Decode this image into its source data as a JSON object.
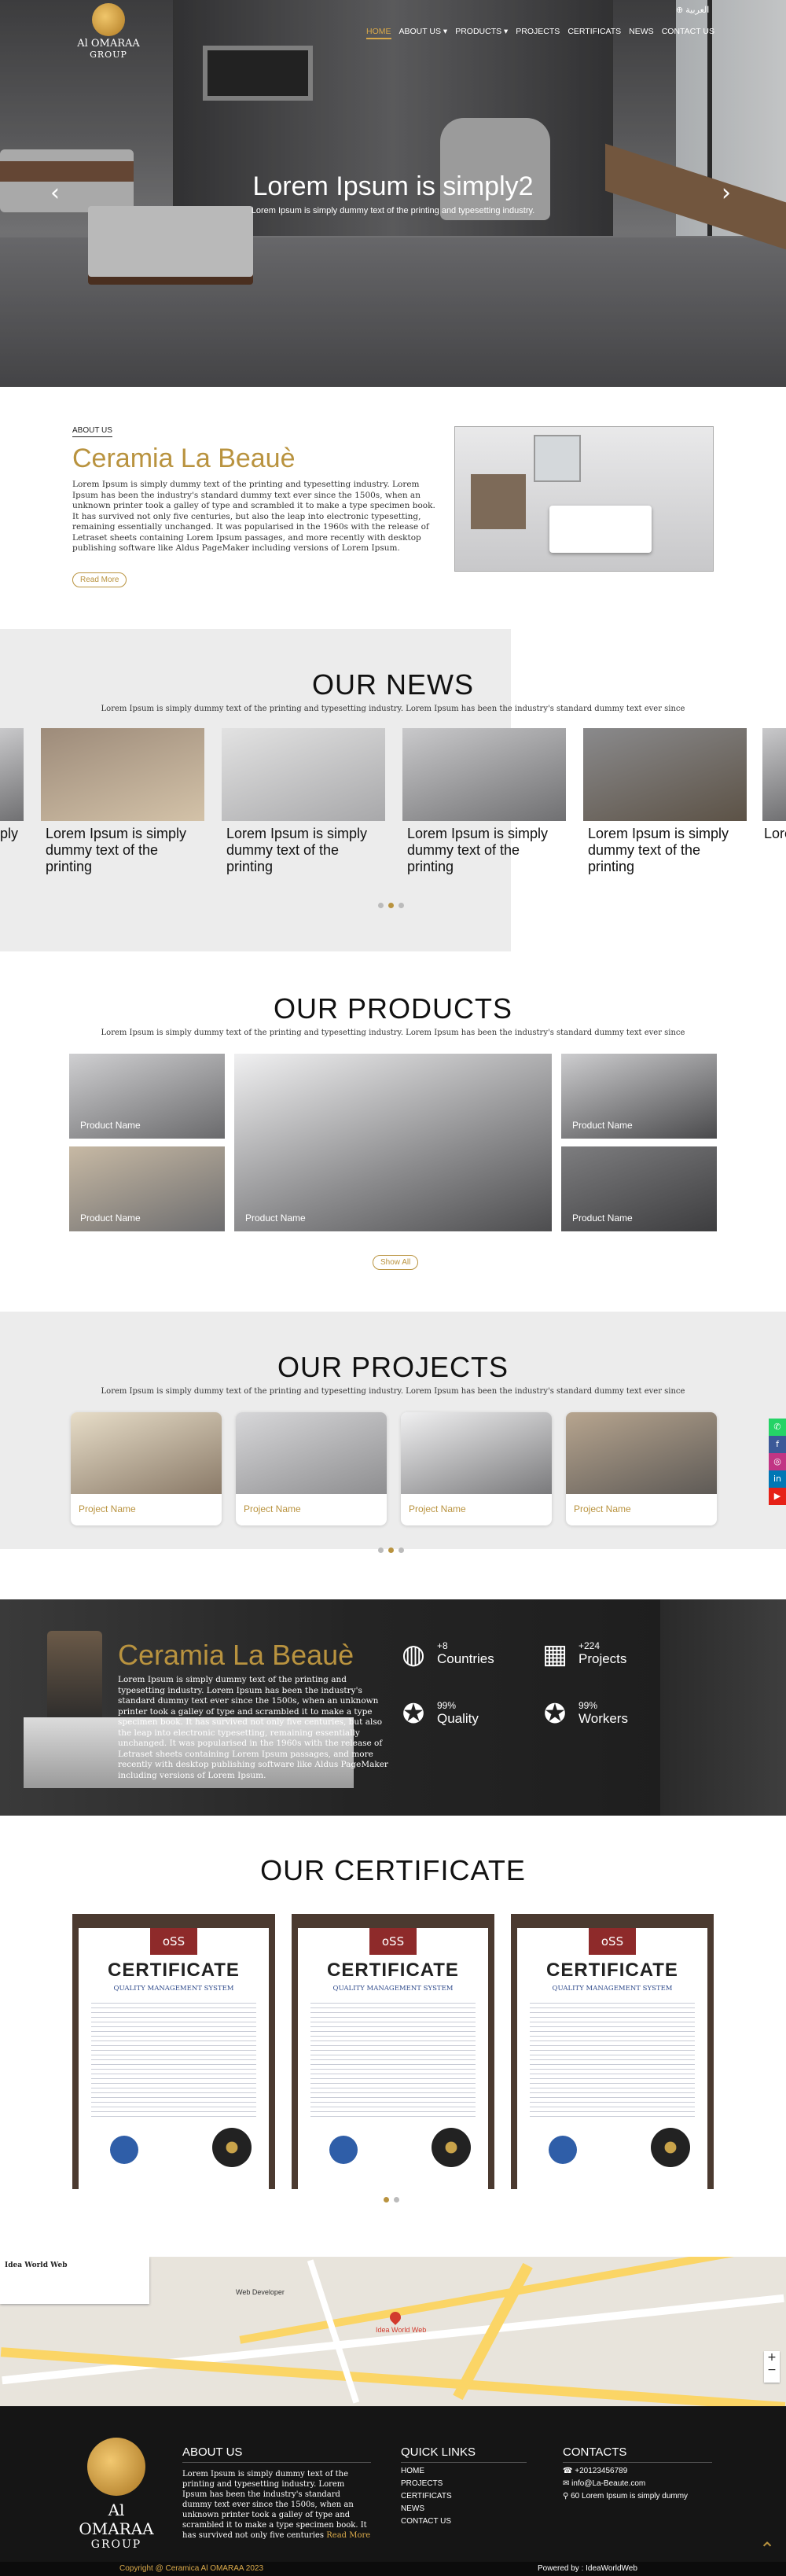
{
  "header": {
    "logo_line1": "Al OMARAA",
    "logo_line2": "GROUP",
    "nav": [
      "HOME",
      "ABOUT US ▾",
      "PRODUCTS ▾",
      "PROJECTS",
      "CERTIFICATS",
      "NEWS",
      "CONTACT US"
    ],
    "language": "العربية"
  },
  "hero": {
    "title": "Lorem Ipsum is simply2",
    "subtitle": "Lorem Ipsum is simply dummy text of the printing and typesetting industry."
  },
  "about": {
    "kicker": "ABOUT US",
    "title": "Ceramia La Beauè",
    "text": "Lorem Ipsum is simply dummy text of the printing and typesetting industry. Lorem Ipsum has been the industry's standard dummy text ever since the 1500s, when an unknown printer took a galley of type and scrambled it to make a type specimen book. It has survived not only five centuries, but also the leap into electronic typesetting, remaining essentially unchanged. It was popularised in the 1960s with the release of Letraset sheets containing Lorem Ipsum passages, and more recently with desktop publishing software like Aldus PageMaker including versions of Lorem Ipsum.",
    "button": "Read More"
  },
  "news": {
    "title": "OUR NEWS",
    "subtitle": "Lorem Ipsum is simply dummy text of the printing and typesetting industry. Lorem Ipsum has been the industry's standard dummy text ever since",
    "items": [
      {
        "text": "ply"
      },
      {
        "text": "Lorem Ipsum is simply dummy text of the printing"
      },
      {
        "text": "Lorem Ipsum is simply dummy text of the printing"
      },
      {
        "text": "Lorem Ipsum is simply dummy text of the printing"
      },
      {
        "text": "Lorem Ipsum is simply dummy text of the printing"
      },
      {
        "text": "Lorem"
      }
    ]
  },
  "products": {
    "title": "OUR PRODUCTS",
    "subtitle": "Lorem Ipsum is simply dummy text of the printing and typesetting industry. Lorem Ipsum has been the industry's standard dummy text ever since",
    "items": [
      "Product Name",
      "Product Name",
      "Product Name",
      "Product Name",
      "Product Name",
      "Product Name"
    ],
    "button": "Show All"
  },
  "projects": {
    "title": "OUR PROJECTS",
    "subtitle": "Lorem Ipsum is simply dummy text of the printing and typesetting industry. Lorem Ipsum has been the industry's standard dummy text ever since",
    "items": [
      "Project Name",
      "Project Name",
      "Project Name",
      "Project Name"
    ]
  },
  "stats": {
    "title": "Ceramia La Beauè",
    "text": "Lorem Ipsum is simply dummy text of the printing and typesetting industry. Lorem Ipsum has been the industry's standard dummy text ever since the 1500s, when an unknown printer took a galley of type and scrambled it to make a type specimen book. It has survived not only five centuries, but also the leap into electronic typesetting, remaining essentially unchanged. It was popularised in the 1960s with the release of Letraset sheets containing Lorem Ipsum passages, and more recently with desktop publishing software like Aldus PageMaker including versions of Lorem Ipsum.",
    "items": [
      {
        "number": "+8",
        "label": "Countries",
        "icon": "globe-pin-icon"
      },
      {
        "number": "+224",
        "label": "Projects",
        "icon": "building-icon"
      },
      {
        "number": "99%",
        "label": "Quality",
        "icon": "badge-icon"
      },
      {
        "number": "99%",
        "label": "Workers",
        "icon": "worker-badge-icon"
      }
    ]
  },
  "certificates": {
    "title": "OUR CERTIFICATE",
    "items": [
      {
        "badge": "oSS",
        "heading": "CERTIFICATE",
        "sub": "QUALITY MANAGEMENT SYSTEM"
      },
      {
        "badge": "oSS",
        "heading": "CERTIFICATE",
        "sub": "QUALITY MANAGEMENT SYSTEM"
      },
      {
        "badge": "oSS",
        "heading": "CERTIFICATE",
        "sub": "QUALITY MANAGEMENT SYSTEM"
      }
    ]
  },
  "map": {
    "place": "Idea World Web",
    "nearby": "Web Developer"
  },
  "footer": {
    "about_title": "ABOUT US",
    "about_text": "Lorem Ipsum is simply dummy text of the printing and typesetting industry. Lorem Ipsum has been the industry's standard dummy text ever since the 1500s, when an unknown printer took a galley of type and scrambled it to make a type specimen book. It has survived not only five centuries",
    "read_more": "Read More",
    "links_title": "QUICK LINKS",
    "links": [
      "HOME",
      "PROJECTS",
      "CERTIFICATS",
      "NEWS",
      "CONTACT US"
    ],
    "contacts_title": "CONTACTS",
    "phone": "+20123456789",
    "email": "info@La-Beaute.com",
    "address": "60 Lorem Ipsum is simply dummy",
    "copyright": "Copyright @ Ceramica Al OMARAA 2023",
    "powered": "Powered by : IdeaWorldWeb"
  },
  "colors": {
    "accent": "#b9933f",
    "dark": "#151515",
    "light_bg": "#ececec"
  }
}
